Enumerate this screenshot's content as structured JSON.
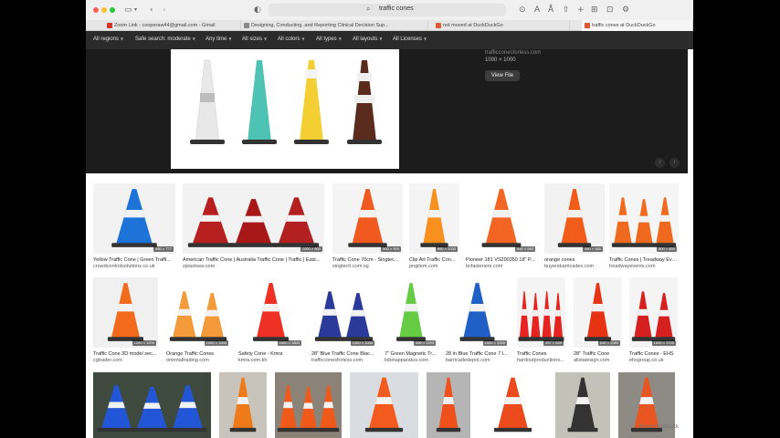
{
  "browser": {
    "url": "traffic cones",
    "tabs": [
      {
        "label": "Zoom Link - cooperaw44@gmail.com - Gmail",
        "color": "#d93025"
      },
      {
        "label": "Designing, Conducting, and Reporting Clinical Decision Sup...",
        "color": "#888888"
      },
      {
        "label": "not moved at DuckDuckGo",
        "color": "#de5833"
      },
      {
        "label": "traffic cones at DuckDuckGo",
        "color": "#de5833"
      }
    ]
  },
  "filters": [
    "All regions",
    "Safe search: moderate",
    "Any time",
    "All sizes",
    "All colors",
    "All types",
    "All layouts",
    "All Licenses"
  ],
  "preview": {
    "source": "trafficconesforless.com",
    "dimensions": "1000 × 1000",
    "view_file_label": "View File",
    "prev_icon": "chevron-left-icon",
    "next_icon": "chevron-right-icon"
  },
  "results_row1": [
    {
      "title": "Yellow Traffic Cone | Green Traffi...",
      "source": "crowdcontrolsolutions.co.uk",
      "size": "580 × 777",
      "colors": [
        "#1e73d8"
      ],
      "bg": "#f2f2f2"
    },
    {
      "title": "American Traffic Cone | Australia Traffic Cone | Traffic | East...",
      "source": "zjeastsea.com",
      "size": "1000 × 600",
      "colors": [
        "#b81f1f",
        "#a81818",
        "#b22020"
      ],
      "bg": "#f2f2f2"
    },
    {
      "title": "Traffic Cone 70cm - Singtec...",
      "source": "singtech.com.sg",
      "size": "500 × 500",
      "colors": [
        "#f05a1e"
      ],
      "bg": "#f4f4f4"
    },
    {
      "title": "Clip Art Traffic Con...",
      "source": "pngitem.com",
      "size": "860 × 1033",
      "colors": [
        "#f7901e"
      ],
      "bg": "#f4f4f4"
    },
    {
      "title": "Pioneer 181 VS200350 18\" P...",
      "source": "bcfasteners.com",
      "size": "640 × 640",
      "colors": [
        "#f26522"
      ],
      "bg": "#ffffff"
    },
    {
      "title": "orange cones",
      "source": "buyersbarricades.com",
      "size": "480 × 480",
      "colors": [
        "#f25c19"
      ],
      "bg": "#f2f2f2"
    },
    {
      "title": "Traffic Cones | Treadway Eve...",
      "source": "treadwayevents.com",
      "size": "800 × 600",
      "colors": [
        "#ef6a1f",
        "#ef6a1f",
        "#ef6a1f"
      ],
      "bg": "#f5f5f5"
    }
  ],
  "results_row2": [
    {
      "title": "Traffic Cone 3D model sec...",
      "source": "cgtrader.com",
      "size": "1200 × 1200",
      "colors": [
        "#f26a1b"
      ],
      "bg": "#f0f0f0"
    },
    {
      "title": "Orange Traffic Cones",
      "source": "orientaltrading.com",
      "size": "1000 × 1000",
      "colors": [
        "#f39a3b",
        "#f39a3b"
      ],
      "bg": "#ffffff"
    },
    {
      "title": "Safety Cone - Kmra",
      "source": "kmra.com.kh",
      "size": "1600 × 1600",
      "colors": [
        "#ee3124"
      ],
      "bg": "#ffffff"
    },
    {
      "title": "28\" Blue Traffic Cone Blac...",
      "source": "trafficconesforless.com",
      "size": "1000 × 1000",
      "colors": [
        "#2b3a9a",
        "#2b3a9a"
      ],
      "bg": "#ffffff"
    },
    {
      "title": "7\" Green Magnetic Tr...",
      "source": "lobinapparatus.com",
      "size": "980 × 1193",
      "colors": [
        "#66cc44"
      ],
      "bg": "#ffffff"
    },
    {
      "title": "28 in Blue Traffic Cone 7 l...",
      "source": "barricadedepot.com",
      "size": "1000 × 1000",
      "colors": [
        "#1f5fc6"
      ],
      "bg": "#ffffff"
    },
    {
      "title": "Traffic Cones",
      "source": "hardoutproductions...",
      "size": "457 × 640",
      "colors": [
        "#e52420",
        "#e52420",
        "#e52420",
        "#e52420"
      ],
      "bg": "#f4f4f4"
    },
    {
      "title": "28\" Traffic Cone",
      "source": "allstatesign.com",
      "size": "640 × 1080",
      "colors": [
        "#e53314"
      ],
      "bg": "#f4f4f4"
    },
    {
      "title": "Traffic Cones - EHS",
      "source": "ehsgroup.co.uk",
      "size": "1600 × 1700",
      "colors": [
        "#d61f1f",
        "#d61f1f"
      ],
      "bg": "#f4f4f4"
    }
  ],
  "results_row3": [
    {
      "colors": [
        "#2356d6",
        "#2356d6",
        "#2356d6"
      ],
      "bg": "#3f4a3f"
    },
    {
      "colors": [
        "#ee7a1a"
      ],
      "bg": "#c8c4bc"
    },
    {
      "colors": [
        "#ef5a1a",
        "#ef5a1a",
        "#ef5a1a"
      ],
      "bg": "#8c8378"
    },
    {
      "colors": [
        "#f35a1e"
      ],
      "bg": "#d9dce0"
    },
    {
      "colors": [
        "#f0501c"
      ],
      "bg": "#b5b5b5"
    },
    {
      "colors": [
        "#ea4a1c"
      ],
      "bg": "#ffffff"
    },
    {
      "colors": [
        "#333333"
      ],
      "bg": "#c2c2b8"
    },
    {
      "colors": [
        "#e85520"
      ],
      "bg": "#8e8a84"
    }
  ],
  "feedback_label": "Share Feedback"
}
